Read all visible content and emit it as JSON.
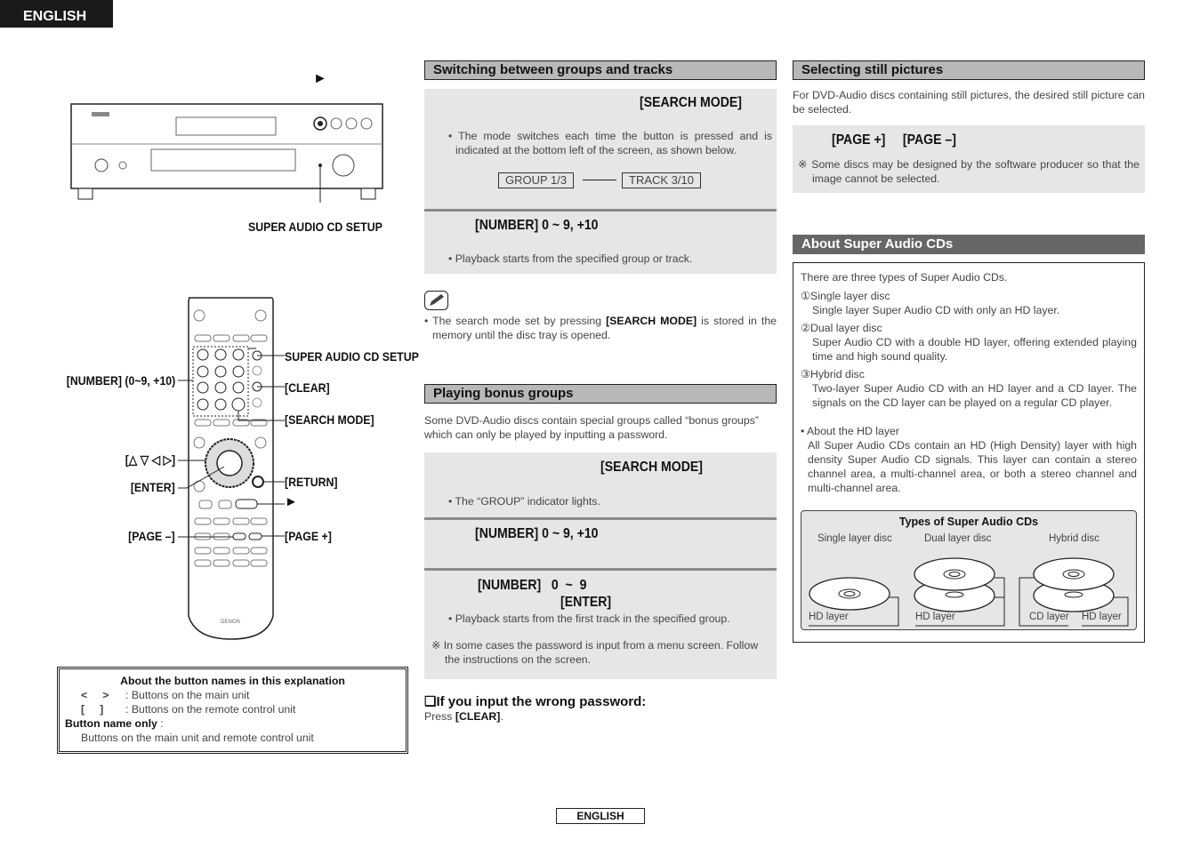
{
  "language_tab": "ENGLISH",
  "footer_label": "ENGLISH",
  "main_unit": {
    "play_symbol": "►",
    "label_setup": "SUPER AUDIO CD SETUP"
  },
  "remote": {
    "labels": {
      "setup": "SUPER AUDIO CD SETUP",
      "number": "[NUMBER] (0~9, +10)",
      "clear": "[CLEAR]",
      "search": "[SEARCH MODE]",
      "cursor": "[△ ▽ ◁ ▷]",
      "enter": "[ENTER]",
      "return": "[RETURN]",
      "play": "►",
      "page_minus": "[PAGE –]",
      "page_plus": "[PAGE +]"
    },
    "brand": "DENON"
  },
  "button_note": {
    "title": "About the button names in this explanation",
    "row1_sym": "<     >",
    "row1_text": ": Buttons on the main unit",
    "row2_sym": "[     ]",
    "row2_text": ": Buttons on the remote control unit",
    "row3_bold": "Button name only",
    "row3_colon": " :",
    "row4": "Buttons on the main unit and remote control unit"
  },
  "switching": {
    "title": "Switching between groups and tracks",
    "step1_key": "[SEARCH MODE]",
    "step1_text": "The mode switches each time the button is pressed and is indicated at the bottom left of the screen, as shown below.",
    "display_a": "GROUP 1/3",
    "display_b": "TRACK 3/10",
    "step2_key": "[NUMBER]  0 ~ 9, +10",
    "step2_text": "Playback starts from the specified group or track.",
    "memo_pre": "The search mode set by pressing ",
    "memo_key": "[SEARCH MODE]",
    "memo_post": " is stored in the memory until the disc tray is opened."
  },
  "bonus": {
    "title": "Playing bonus groups",
    "intro": "Some DVD-Audio discs contain special groups called “bonus groups” which can only be played by inputting a password.",
    "step1_key": "[SEARCH MODE]",
    "step1_text": "The “GROUP” indicator lights.",
    "step2_key": "[NUMBER]  0 ~ 9, +10",
    "step3_key": "[NUMBER]   0  ~  9",
    "step3_key2": "[ENTER]",
    "step3_text": "Playback starts from the first track in the specified group.",
    "note": "In some cases the password is input from a menu screen. Follow the instructions on the screen.",
    "wrong_title": "If you input the wrong password:",
    "wrong_pre": "Press ",
    "wrong_key": "[CLEAR]",
    "wrong_post": "."
  },
  "still": {
    "title": "Selecting still pictures",
    "intro": "For DVD-Audio discs containing still pictures, the desired still picture can be selected.",
    "keys": "[PAGE +]     [PAGE –]",
    "note": "Some discs may be designed by the software producer so that the image cannot be selected."
  },
  "sacd": {
    "title": "About Super Audio CDs",
    "intro": "There are three types of Super Audio CDs.",
    "types": [
      {
        "num": "①",
        "name": "Single layer disc",
        "desc": "Single layer Super Audio CD with only an HD layer."
      },
      {
        "num": "②",
        "name": "Dual layer disc",
        "desc": "Super Audio CD with a double HD layer, offering extended playing time and high sound quality."
      },
      {
        "num": "③",
        "name": "Hybrid disc",
        "desc": "Two-layer Super Audio CD with an HD layer and a CD layer. The signals on the CD layer can be played on a regular CD player."
      }
    ],
    "hd_title": "About the HD layer",
    "hd_text": "All Super Audio CDs contain an HD (High Density) layer with high density Super Audio CD signals. This layer can contain a stereo channel area, a multi-channel area, or both a stereo channel and multi-channel area.",
    "figure": {
      "title": "Types of Super Audio CDs",
      "col1": "Single layer disc",
      "col2": "Dual layer disc",
      "col3": "Hybrid disc",
      "hd": "HD layer",
      "cd": "CD layer"
    }
  }
}
